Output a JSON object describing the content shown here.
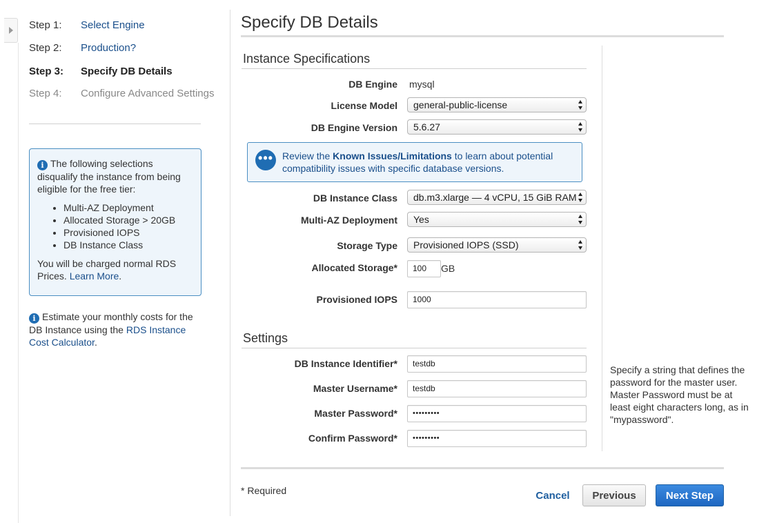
{
  "wizard": {
    "steps": [
      {
        "num": "Step 1:",
        "label": "Select Engine"
      },
      {
        "num": "Step 2:",
        "label": "Production?"
      },
      {
        "num": "Step 3:",
        "label": "Specify DB Details"
      },
      {
        "num": "Step 4:",
        "label": "Configure Advanced Settings"
      }
    ]
  },
  "free_tier_notice": {
    "text": "The following selections disqualify the instance from being eligible for the free tier:",
    "items": [
      "Multi-AZ Deployment",
      "Allocated Storage > 20GB",
      "Provisioned IOPS",
      "DB Instance Class"
    ],
    "footer_text": "You will be charged normal RDS Prices.",
    "link": "Learn More",
    "footer_end": "."
  },
  "estimate_note": {
    "text": "Estimate your monthly costs for the DB Instance using the",
    "link": "RDS Instance Cost Calculator",
    "end": "."
  },
  "page_title": "Specify DB Details",
  "instance_specs": {
    "title": "Instance Specifications",
    "db_engine_label": "DB Engine",
    "db_engine_value": "mysql",
    "license_model_label": "License Model",
    "license_model_value": "general-public-license",
    "engine_version_label": "DB Engine Version",
    "engine_version_value": "5.6.27",
    "known_issues": {
      "prefix": "Review the",
      "link": "Known Issues/Limitations",
      "suffix": "to learn about potential compatibility issues with specific database versions.",
      "icon_glyph": "•••"
    },
    "instance_class_label": "DB Instance Class",
    "instance_class_value": "db.m3.xlarge — 4 vCPU, 15 GiB RAM",
    "multi_az_label": "Multi-AZ Deployment",
    "multi_az_value": "Yes",
    "storage_type_label": "Storage Type",
    "storage_type_value": "Provisioned IOPS (SSD)",
    "allocated_storage_label": "Allocated Storage*",
    "allocated_storage_value": "100",
    "allocated_storage_unit": "GB",
    "provisioned_iops_label": "Provisioned IOPS",
    "provisioned_iops_value": "1000"
  },
  "settings": {
    "title": "Settings",
    "identifier_label": "DB Instance Identifier*",
    "identifier_value": "testdb",
    "username_label": "Master Username*",
    "username_value": "testdb",
    "password_label": "Master Password*",
    "password_value": "•••••••••",
    "confirm_label": "Confirm Password*",
    "confirm_value": "•••••••••",
    "help_text": "Specify a string that defines the password for the master user. Master Password must be at least eight characters long, as in \"mypassword\"."
  },
  "footer": {
    "required_note": "* Required",
    "cancel": "Cancel",
    "previous": "Previous",
    "next": "Next Step"
  },
  "colors": {
    "link": "#1a4f8b",
    "info_border": "#4a8ec2",
    "info_bg": "#eef5fb",
    "primary_button": "#1e67c1"
  }
}
